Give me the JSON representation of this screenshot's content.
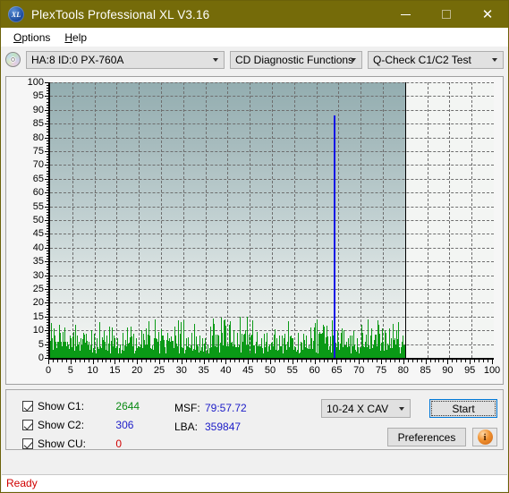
{
  "window": {
    "title": "PlexTools Professional XL V3.16",
    "icon": "xl-app-icon",
    "icon_text": "XL",
    "titlebar_color": "#756b09",
    "minimize_label": "─",
    "maximize_label": "□",
    "close_label": "✕"
  },
  "menubar": {
    "items": [
      {
        "label": "Options",
        "accel": "O"
      },
      {
        "label": "Help",
        "accel": "H"
      }
    ]
  },
  "toolbar": {
    "drive_icon": "optical-disc-icon",
    "drive_combo": {
      "value": "HA:8 ID:0  PX-760A"
    },
    "function_combo": {
      "value": "CD Diagnostic Functions"
    },
    "test_combo": {
      "value": "Q-Check C1/C2 Test"
    }
  },
  "chart_data": {
    "type": "bar",
    "title": "",
    "xlabel": "",
    "ylabel": "",
    "xlim": [
      0,
      100
    ],
    "ylim": [
      0,
      100
    ],
    "xticks": [
      0,
      5,
      10,
      15,
      20,
      25,
      30,
      35,
      40,
      45,
      50,
      55,
      60,
      65,
      70,
      75,
      80,
      85,
      90,
      95,
      100
    ],
    "yticks": [
      0,
      5,
      10,
      15,
      20,
      25,
      30,
      35,
      40,
      45,
      50,
      55,
      60,
      65,
      70,
      75,
      80,
      85,
      90,
      95,
      100
    ],
    "grid": true,
    "legend": "none",
    "data_end_x": 80,
    "colors": {
      "c1": "#0a9a16",
      "c2": "#1414e6",
      "cu": "#d00000"
    },
    "series": [
      {
        "name": "C1",
        "color": "#0a9a16",
        "points": [
          [
            0.2,
            2
          ],
          [
            0.5,
            7
          ],
          [
            0.8,
            3
          ],
          [
            1.0,
            8
          ],
          [
            1.3,
            4
          ],
          [
            1.5,
            2
          ],
          [
            1.7,
            6
          ],
          [
            2.0,
            3
          ],
          [
            2.3,
            9
          ],
          [
            2.5,
            2
          ],
          [
            2.8,
            5
          ],
          [
            3.0,
            3
          ],
          [
            3.3,
            11
          ],
          [
            3.6,
            2
          ],
          [
            3.9,
            6
          ],
          [
            4.1,
            3
          ],
          [
            4.4,
            8
          ],
          [
            4.7,
            2
          ],
          [
            5.0,
            4
          ],
          [
            5.3,
            3
          ],
          [
            5.6,
            12
          ],
          [
            5.9,
            2
          ],
          [
            6.2,
            5
          ],
          [
            6.5,
            3
          ],
          [
            6.8,
            7
          ],
          [
            7.1,
            2
          ],
          [
            7.4,
            9
          ],
          [
            7.7,
            3
          ],
          [
            8.0,
            4
          ],
          [
            8.3,
            2
          ],
          [
            8.6,
            6
          ],
          [
            8.9,
            3
          ],
          [
            9.2,
            10
          ],
          [
            9.5,
            2
          ],
          [
            9.8,
            5
          ],
          [
            10.1,
            3
          ],
          [
            10.4,
            7
          ],
          [
            10.7,
            2
          ],
          [
            11.0,
            13
          ],
          [
            11.3,
            3
          ],
          [
            11.6,
            4
          ],
          [
            11.9,
            2
          ],
          [
            12.2,
            6
          ],
          [
            12.5,
            3
          ],
          [
            12.8,
            8
          ],
          [
            13.1,
            2
          ],
          [
            13.4,
            5
          ],
          [
            13.7,
            3
          ],
          [
            14.0,
            11
          ],
          [
            14.3,
            2
          ],
          [
            14.6,
            4
          ],
          [
            14.9,
            3
          ],
          [
            15.2,
            7
          ],
          [
            15.5,
            2
          ],
          [
            15.8,
            5
          ],
          [
            16.1,
            3
          ],
          [
            16.4,
            9
          ],
          [
            16.7,
            2
          ],
          [
            17.0,
            6
          ],
          [
            17.3,
            3
          ],
          [
            17.6,
            4
          ],
          [
            17.9,
            2
          ],
          [
            18.2,
            8
          ],
          [
            18.5,
            3
          ],
          [
            18.8,
            5
          ],
          [
            19.1,
            2
          ],
          [
            19.4,
            7
          ],
          [
            19.7,
            3
          ],
          [
            20.0,
            4
          ],
          [
            20.3,
            2
          ],
          [
            20.6,
            10
          ],
          [
            20.9,
            3
          ],
          [
            21.2,
            6
          ],
          [
            21.5,
            2
          ],
          [
            21.8,
            5
          ],
          [
            22.1,
            3
          ],
          [
            22.4,
            8
          ],
          [
            22.7,
            2
          ],
          [
            23.0,
            4
          ],
          [
            23.3,
            3
          ],
          [
            23.5,
            14
          ],
          [
            23.8,
            2
          ],
          [
            24.1,
            6
          ],
          [
            24.4,
            3
          ],
          [
            24.7,
            5
          ],
          [
            25.0,
            2
          ],
          [
            25.3,
            7
          ],
          [
            25.6,
            3
          ],
          [
            25.9,
            4
          ],
          [
            26.2,
            2
          ],
          [
            26.5,
            9
          ],
          [
            26.8,
            3
          ],
          [
            27.1,
            6
          ],
          [
            27.4,
            2
          ],
          [
            27.7,
            5
          ],
          [
            28.0,
            3
          ],
          [
            28.3,
            8
          ],
          [
            28.6,
            2
          ],
          [
            28.9,
            4
          ],
          [
            29.2,
            3
          ],
          [
            29.5,
            6
          ],
          [
            29.8,
            2
          ],
          [
            30.1,
            5
          ],
          [
            30.4,
            3
          ],
          [
            30.7,
            7
          ],
          [
            31.0,
            2
          ],
          [
            31.3,
            4
          ],
          [
            31.6,
            3
          ],
          [
            31.9,
            9
          ],
          [
            32.2,
            2
          ],
          [
            32.5,
            6
          ],
          [
            32.8,
            3
          ],
          [
            33.1,
            5
          ],
          [
            33.4,
            2
          ],
          [
            33.7,
            8
          ],
          [
            34.0,
            3
          ],
          [
            34.3,
            4
          ],
          [
            34.6,
            2
          ],
          [
            34.9,
            7
          ],
          [
            35.2,
            3
          ],
          [
            35.5,
            5
          ],
          [
            35.8,
            2
          ],
          [
            36.1,
            10
          ],
          [
            36.4,
            3
          ],
          [
            36.7,
            6
          ],
          [
            37.0,
            2
          ],
          [
            37.3,
            4
          ],
          [
            37.6,
            3
          ],
          [
            37.9,
            8
          ],
          [
            38.2,
            2
          ],
          [
            38.5,
            5
          ],
          [
            38.8,
            3
          ],
          [
            39.1,
            7
          ],
          [
            39.4,
            2
          ],
          [
            39.7,
            4
          ],
          [
            40.0,
            3
          ],
          [
            40.3,
            12
          ],
          [
            40.6,
            2
          ],
          [
            40.9,
            6
          ],
          [
            41.2,
            3
          ],
          [
            41.5,
            5
          ],
          [
            41.8,
            2
          ],
          [
            42.1,
            9
          ],
          [
            42.4,
            3
          ],
          [
            42.7,
            15
          ],
          [
            43.0,
            2
          ],
          [
            43.3,
            6
          ],
          [
            43.6,
            4
          ],
          [
            43.9,
            7
          ],
          [
            44.2,
            2
          ],
          [
            44.5,
            5
          ],
          [
            44.8,
            3
          ],
          [
            45.1,
            8
          ],
          [
            45.4,
            2
          ],
          [
            45.7,
            4
          ],
          [
            46.0,
            3
          ],
          [
            46.3,
            6
          ],
          [
            46.6,
            2
          ],
          [
            46.9,
            5
          ],
          [
            47.2,
            3
          ],
          [
            47.5,
            7
          ],
          [
            47.8,
            2
          ],
          [
            48.1,
            4
          ],
          [
            48.4,
            3
          ],
          [
            48.7,
            9
          ],
          [
            49.0,
            2
          ],
          [
            49.3,
            5
          ],
          [
            49.6,
            3
          ],
          [
            49.9,
            6
          ],
          [
            50.2,
            2
          ],
          [
            50.5,
            4
          ],
          [
            50.8,
            3
          ],
          [
            51.1,
            7
          ],
          [
            51.4,
            2
          ],
          [
            51.7,
            5
          ],
          [
            52.0,
            3
          ],
          [
            52.3,
            8
          ],
          [
            52.6,
            2
          ],
          [
            52.9,
            4
          ],
          [
            53.2,
            3
          ],
          [
            53.5,
            6
          ],
          [
            53.8,
            2
          ],
          [
            54.1,
            5
          ],
          [
            54.4,
            3
          ],
          [
            54.7,
            7
          ],
          [
            55.0,
            2
          ],
          [
            55.3,
            4
          ],
          [
            55.6,
            3
          ],
          [
            55.9,
            9
          ],
          [
            56.2,
            2
          ],
          [
            56.5,
            6
          ],
          [
            56.8,
            3
          ],
          [
            57.1,
            5
          ],
          [
            57.4,
            2
          ],
          [
            57.7,
            8
          ],
          [
            58.0,
            3
          ],
          [
            58.3,
            4
          ],
          [
            58.6,
            2
          ],
          [
            58.9,
            7
          ],
          [
            59.2,
            3
          ],
          [
            59.5,
            11
          ],
          [
            59.8,
            2
          ],
          [
            60.1,
            5
          ],
          [
            60.4,
            3
          ],
          [
            60.7,
            6
          ],
          [
            61.0,
            2
          ],
          [
            61.3,
            9
          ],
          [
            61.6,
            3
          ],
          [
            61.9,
            4
          ],
          [
            62.2,
            2
          ],
          [
            62.5,
            7
          ],
          [
            62.8,
            3
          ],
          [
            63.1,
            5
          ],
          [
            63.4,
            2
          ],
          [
            63.7,
            8
          ],
          [
            64.0,
            3
          ],
          [
            64.3,
            4
          ],
          [
            64.6,
            2
          ],
          [
            64.9,
            6
          ],
          [
            65.2,
            3
          ],
          [
            65.5,
            5
          ],
          [
            65.8,
            2
          ],
          [
            66.1,
            10
          ],
          [
            66.4,
            3
          ],
          [
            66.7,
            6
          ],
          [
            67.0,
            2
          ],
          [
            67.3,
            4
          ],
          [
            67.6,
            3
          ],
          [
            67.9,
            8
          ],
          [
            68.2,
            2
          ],
          [
            68.5,
            5
          ],
          [
            68.8,
            3
          ],
          [
            69.1,
            7
          ],
          [
            69.4,
            2
          ],
          [
            69.7,
            4
          ],
          [
            70.0,
            3
          ],
          [
            70.3,
            9
          ],
          [
            70.6,
            2
          ],
          [
            70.9,
            6
          ],
          [
            71.2,
            3
          ],
          [
            71.5,
            5
          ],
          [
            71.8,
            2
          ],
          [
            72.1,
            8
          ],
          [
            72.4,
            3
          ],
          [
            72.7,
            4
          ],
          [
            73.0,
            2
          ],
          [
            73.3,
            7
          ],
          [
            73.6,
            3
          ],
          [
            73.9,
            12
          ],
          [
            74.2,
            2
          ],
          [
            74.5,
            5
          ],
          [
            74.8,
            3
          ],
          [
            75.1,
            6
          ],
          [
            75.4,
            2
          ],
          [
            75.7,
            9
          ],
          [
            76.0,
            3
          ],
          [
            76.3,
            4
          ],
          [
            76.6,
            2
          ],
          [
            76.9,
            7
          ],
          [
            77.2,
            3
          ],
          [
            77.5,
            5
          ],
          [
            77.8,
            2
          ],
          [
            78.1,
            8
          ],
          [
            78.4,
            3
          ],
          [
            78.7,
            4
          ],
          [
            79.0,
            2
          ],
          [
            79.3,
            6
          ],
          [
            79.6,
            3
          ],
          [
            79.9,
            5
          ]
        ]
      },
      {
        "name": "C2",
        "color": "#1414e6",
        "points": [
          [
            64.0,
            88
          ]
        ]
      }
    ]
  },
  "stats": {
    "rows": [
      {
        "checked": true,
        "label": "Show C1:",
        "value": "2644",
        "color": "#0a8a14",
        "name": "show-c1"
      },
      {
        "checked": true,
        "label": "Show C2:",
        "value": "306",
        "color": "#1c1cc8",
        "name": "show-c2"
      },
      {
        "checked": true,
        "label": "Show CU:",
        "value": "0",
        "color": "#d00000",
        "name": "show-cu"
      }
    ],
    "msf_label": "MSF:",
    "msf_value": "79:57.72",
    "lba_label": "LBA:",
    "lba_value": "359847"
  },
  "controls": {
    "speed_combo": {
      "value": "10-24 X CAV"
    },
    "start_button": {
      "label": "Start",
      "accel": "S"
    },
    "preferences_button": {
      "label": "Preferences",
      "accel": "P"
    },
    "info_button": {
      "icon": "info-icon",
      "glyph": "i"
    }
  },
  "statusbar": {
    "text": "Ready",
    "color": "#d00000"
  }
}
